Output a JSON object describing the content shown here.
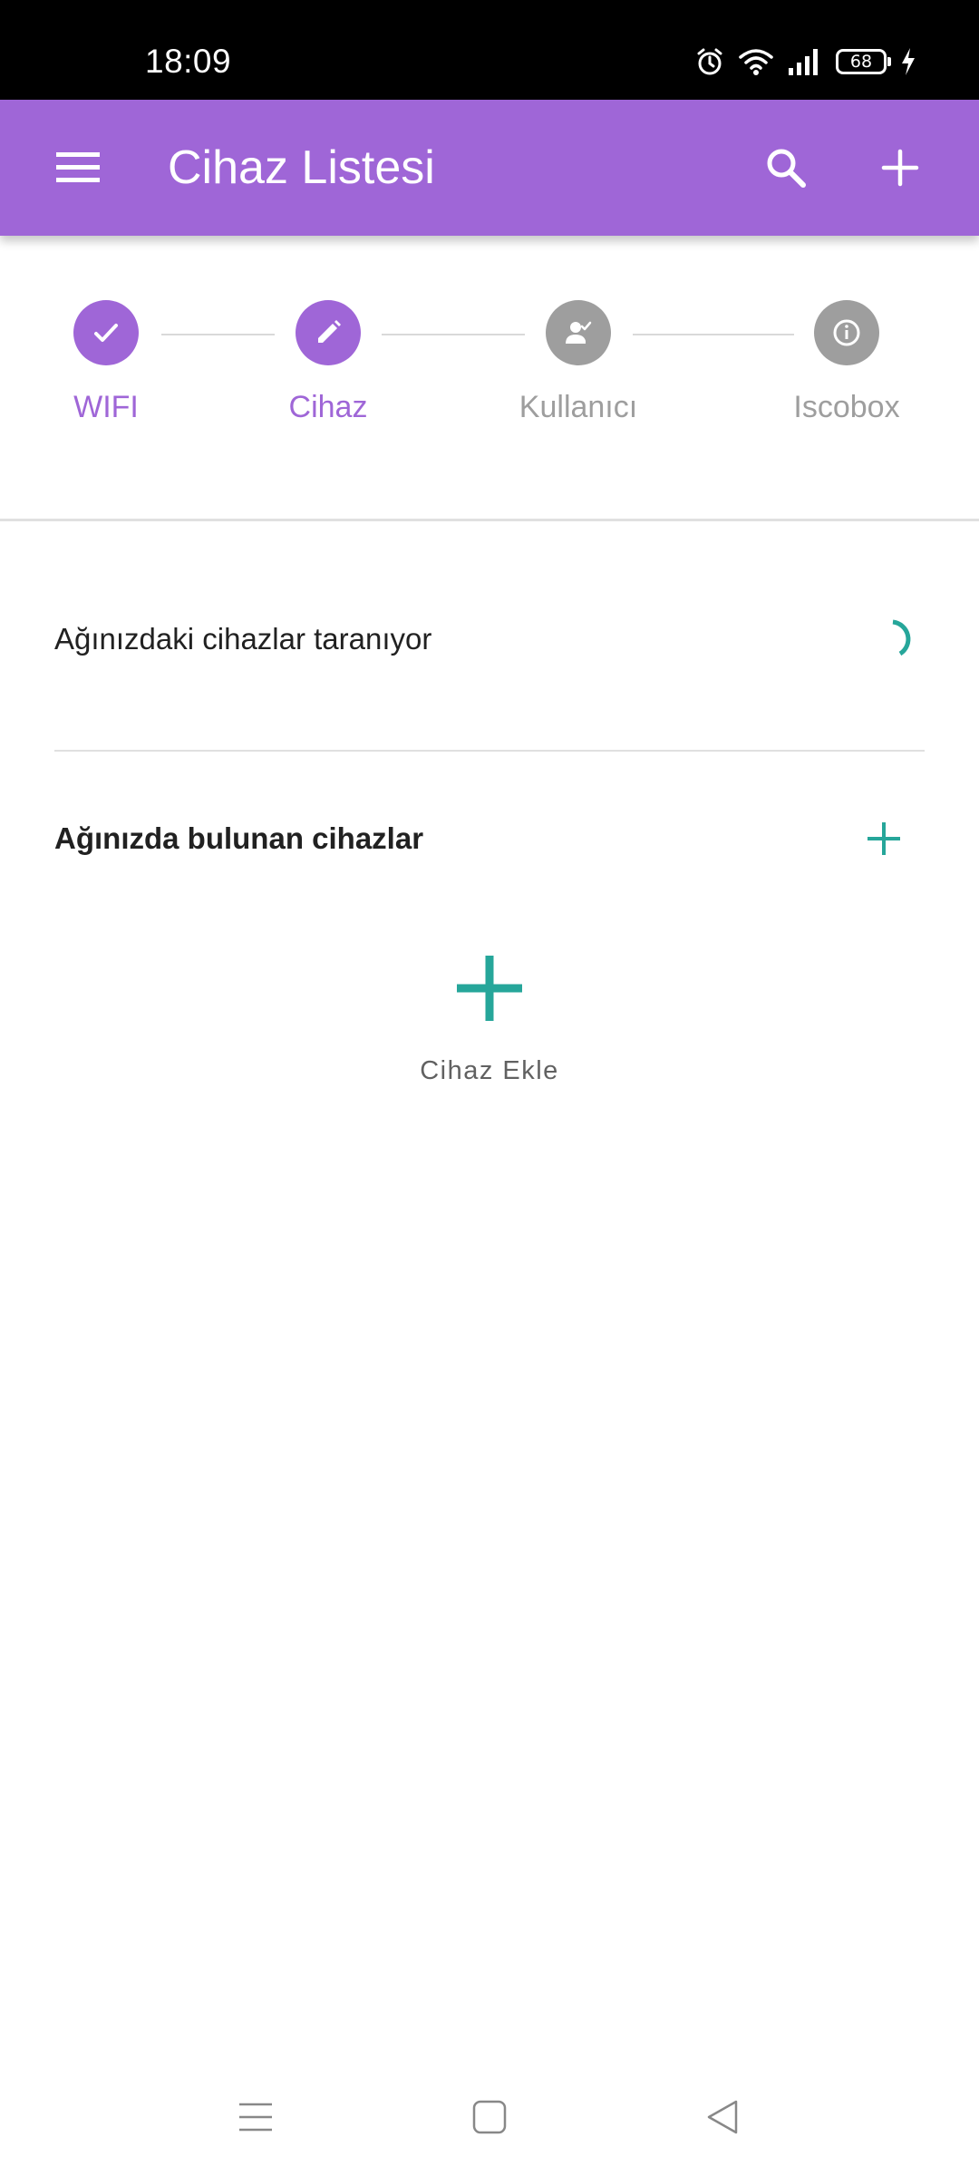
{
  "status_bar": {
    "time": "18:09",
    "battery": "68",
    "icons": [
      "alarm-icon",
      "wifi-icon",
      "signal-icon",
      "battery-icon",
      "charging-icon"
    ]
  },
  "app_bar": {
    "title": "Cihaz Listesi",
    "icons": [
      "menu-icon",
      "search-icon",
      "add-icon"
    ],
    "color": "#9f66d7"
  },
  "stepper": {
    "steps": [
      {
        "label": "WIFI",
        "state": "completed",
        "icon": "check-icon"
      },
      {
        "label": "Cihaz",
        "state": "editing",
        "icon": "pencil-icon"
      },
      {
        "label": "Kullanıcı",
        "state": "inactive",
        "icon": "user-check-icon"
      },
      {
        "label": "Iscobox",
        "state": "inactive",
        "icon": "info-icon"
      }
    ],
    "active_color": "#9f66d7",
    "inactive_color": "#9e9e9e"
  },
  "scan": {
    "text": "Ağınızdaki cihazlar taranıyor",
    "spinner_color": "#26a69a"
  },
  "devices": {
    "title": "Ağınızda bulunan cihazlar",
    "add_label": "Cihaz Ekle",
    "accent_color": "#26a69a"
  },
  "nav_bar": {
    "icons": [
      "recents-icon",
      "home-icon",
      "back-icon"
    ]
  }
}
